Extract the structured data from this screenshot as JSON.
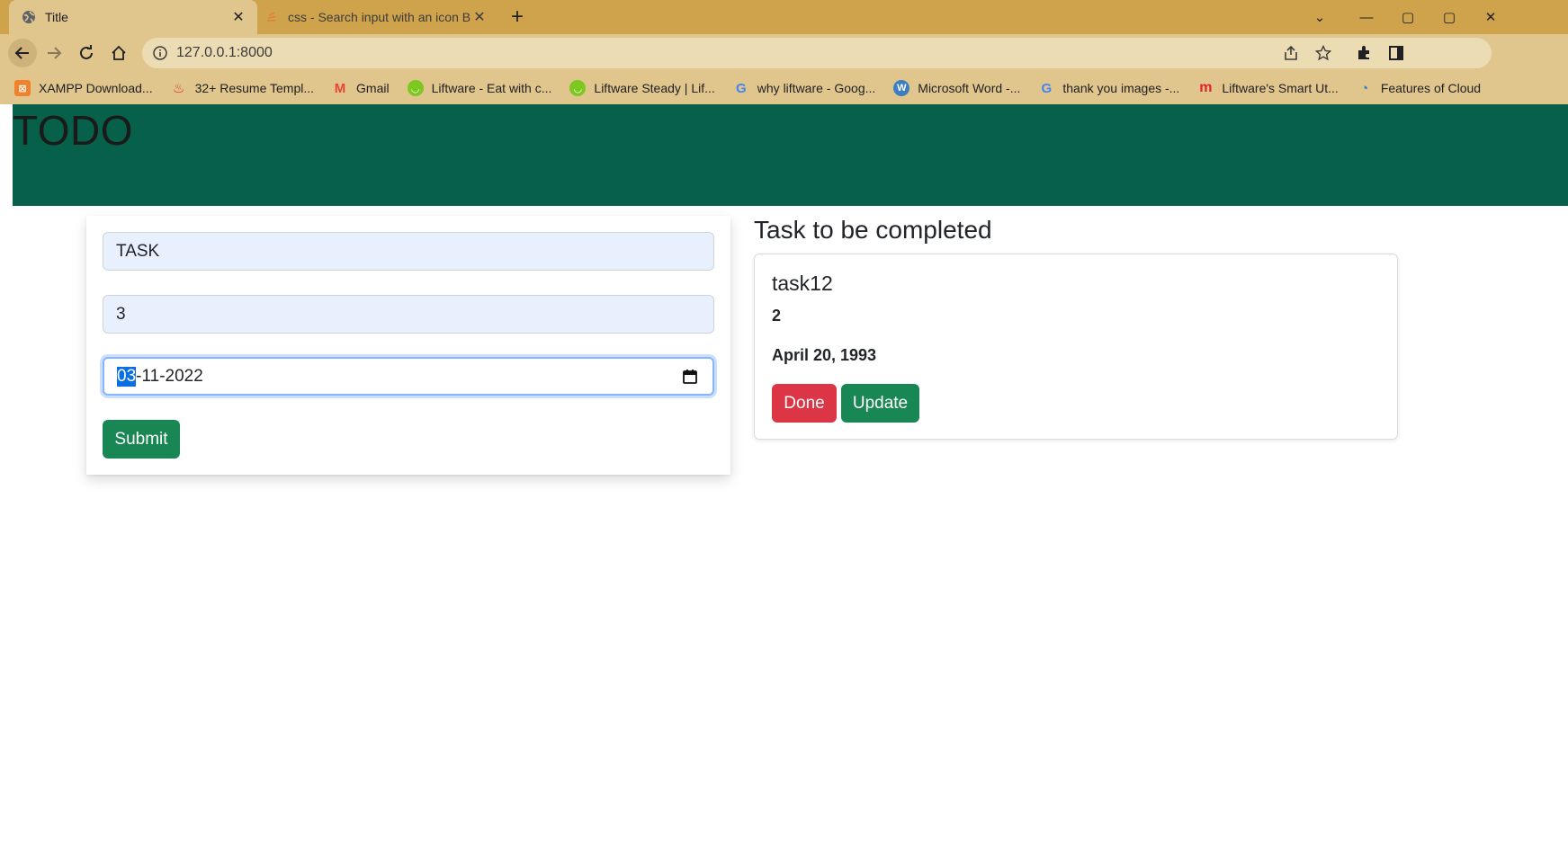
{
  "browser": {
    "tabs": [
      {
        "title": "Title",
        "active": true
      },
      {
        "title": "css - Search input with an icon B",
        "active": false
      }
    ],
    "address": "127.0.0.1:8000",
    "bookmarks": [
      {
        "label": "XAMPP Download...",
        "icon": "xampp-icon",
        "color": "#f0822e"
      },
      {
        "label": "32+ Resume Templ...",
        "icon": "resume-icon",
        "color": "#d93025"
      },
      {
        "label": "Gmail",
        "icon": "gmail-icon",
        "color": "#ea4335"
      },
      {
        "label": "Liftware - Eat with c...",
        "icon": "liftware-icon",
        "color": "#7cc81e"
      },
      {
        "label": "Liftware Steady | Lif...",
        "icon": "liftware-icon",
        "color": "#7cc81e"
      },
      {
        "label": "why liftware - Goog...",
        "icon": "google-icon",
        "color": "#4285f4"
      },
      {
        "label": "Microsoft Word -...",
        "icon": "wordpress-icon",
        "color": "#3b7ec1"
      },
      {
        "label": "thank you images -...",
        "icon": "google-icon",
        "color": "#4285f4"
      },
      {
        "label": "Liftware's Smart Ut...",
        "icon": "m-logo-icon",
        "color": "#e0202a"
      },
      {
        "label": "Features of Cloud",
        "icon": "edge-icon",
        "color": "#2f7ad0"
      }
    ]
  },
  "header": {
    "title": "TODO"
  },
  "form": {
    "task_value": "TASK",
    "number_value": "3",
    "date_day": "03",
    "date_rest": "-11-2022",
    "submit_label": "Submit"
  },
  "list": {
    "title": "Task to be completed",
    "task": {
      "name": "task12",
      "number": "2",
      "date": "April 20, 1993",
      "done_label": "Done",
      "update_label": "Update"
    }
  },
  "colors": {
    "header_bg": "#07604a",
    "success": "#198754",
    "danger": "#dc3545",
    "chrome": "#cfa24c"
  }
}
